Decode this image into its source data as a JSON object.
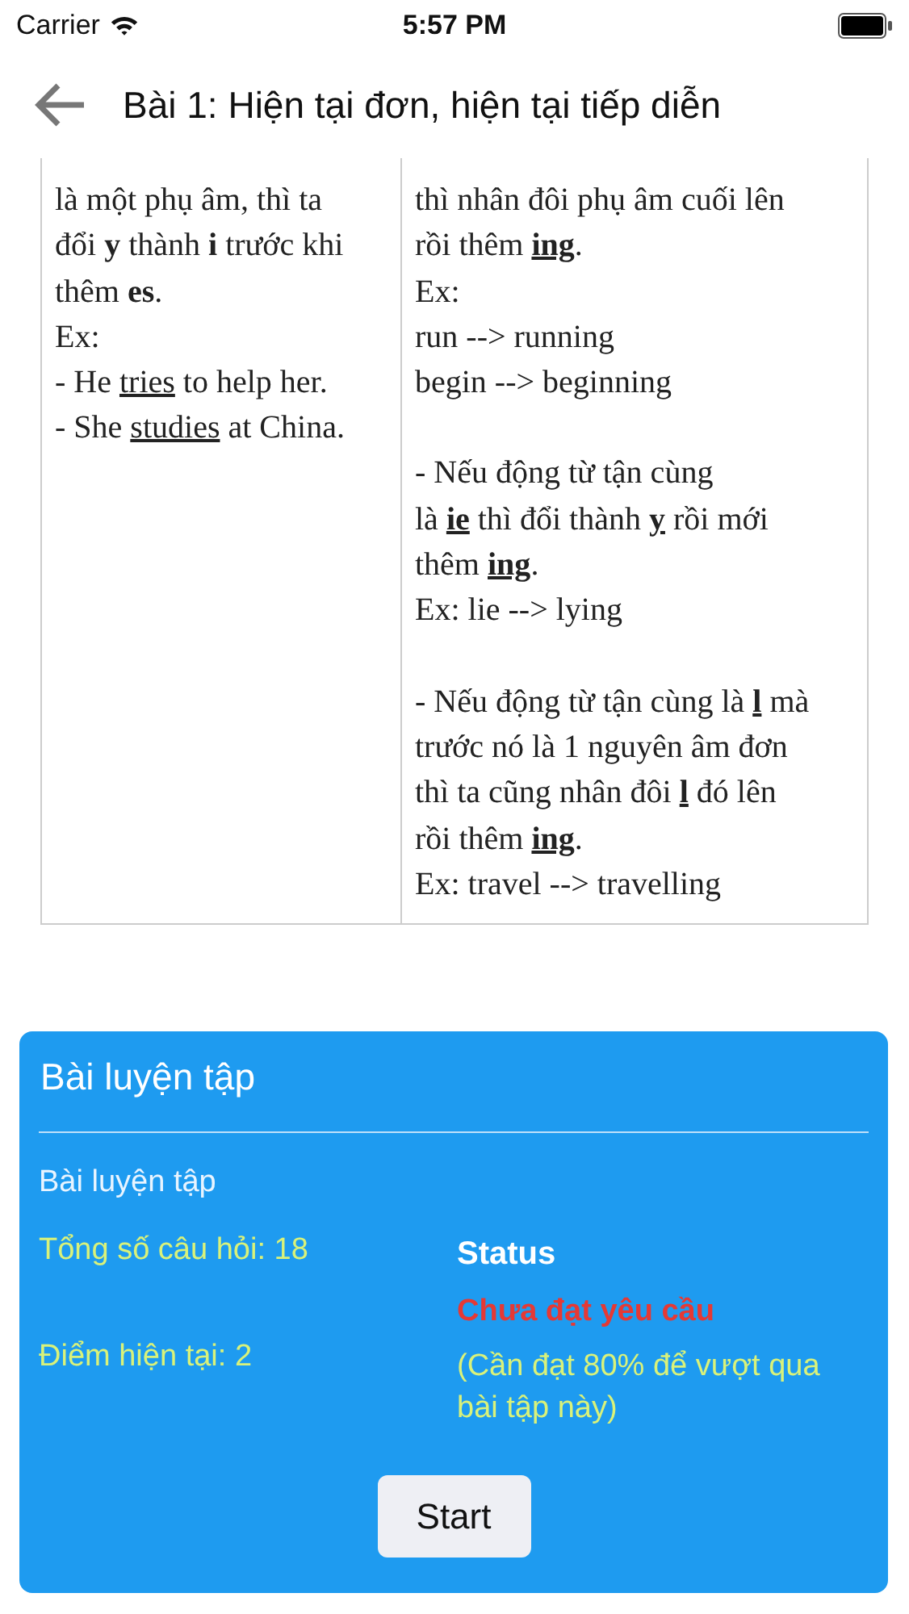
{
  "status_bar": {
    "carrier": "Carrier",
    "time": "5:57 PM"
  },
  "nav": {
    "title": "Bài 1: Hiện tại đơn, hiện tại tiếp diễn"
  },
  "table": {
    "cells": [
      {
        "paragraphs": [
          [
            [
              {
                "t": "là một phụ âm, thì ta"
              }
            ],
            [
              {
                "t": "đổi "
              },
              {
                "t": "y",
                "b": true
              },
              {
                "t": " thành "
              },
              {
                "t": "i",
                "b": true
              },
              {
                "t": " trước khi"
              }
            ],
            [
              {
                "t": "thêm "
              },
              {
                "t": "es",
                "b": true
              },
              {
                "t": "."
              }
            ],
            [
              {
                "t": "Ex:"
              }
            ],
            [
              {
                "t": "- He "
              },
              {
                "t": "tries",
                "u": true
              },
              {
                "t": " to help her."
              }
            ],
            [
              {
                "t": "- She "
              },
              {
                "t": "studies",
                "u": true
              },
              {
                "t": " at China."
              }
            ]
          ]
        ]
      },
      {
        "paragraphs": [
          [
            [
              {
                "t": "thì nhân đôi phụ âm cuối lên"
              }
            ],
            [
              {
                "t": "rồi thêm "
              },
              {
                "t": "ing",
                "b": true,
                "u": true
              },
              {
                "t": "."
              }
            ],
            [
              {
                "t": "Ex:"
              }
            ],
            [
              {
                "t": "run --> running"
              }
            ],
            [
              {
                "t": "begin --> beginning"
              }
            ]
          ],
          [
            [
              {
                "t": "- Nếu động từ tận cùng"
              }
            ],
            [
              {
                "t": "là "
              },
              {
                "t": "ie",
                "b": true,
                "u": true
              },
              {
                "t": " thì đổi thành "
              },
              {
                "t": "y",
                "b": true,
                "u": true
              },
              {
                "t": " rồi mới"
              }
            ],
            [
              {
                "t": "thêm "
              },
              {
                "t": "ing",
                "b": true,
                "u": true
              },
              {
                "t": "."
              }
            ],
            [
              {
                "t": "Ex: lie --> lying"
              }
            ]
          ],
          [
            [
              {
                "t": "- Nếu động từ tận cùng là "
              },
              {
                "t": "l",
                "b": true,
                "u": true
              },
              {
                "t": " mà"
              }
            ],
            [
              {
                "t": "trước nó là 1 nguyên âm đơn"
              }
            ],
            [
              {
                "t": "thì ta cũng nhân đôi "
              },
              {
                "t": "l",
                "b": true,
                "u": true
              },
              {
                "t": " đó lên"
              }
            ],
            [
              {
                "t": "rồi thêm "
              },
              {
                "t": "ing",
                "b": true,
                "u": true
              },
              {
                "t": "."
              }
            ],
            [
              {
                "t": "Ex: travel --> travelling"
              }
            ]
          ]
        ]
      }
    ]
  },
  "practice_card": {
    "title": "Bài luyện tập",
    "subtitle": "Bài luyện tập",
    "total_questions": "Tổng số câu hỏi: 18",
    "current_score": "Điểm hiện tại: 2",
    "status_label": "Status",
    "status_value": "Chưa đạt yêu cầu",
    "status_passed": false,
    "requirement": "(Cần đạt 80% để vượt qua bài tập này)",
    "start_button": "Start"
  }
}
